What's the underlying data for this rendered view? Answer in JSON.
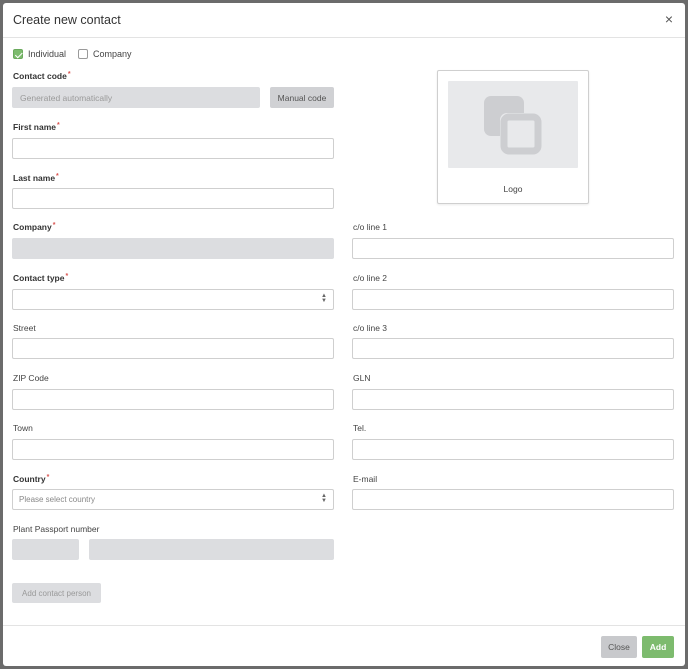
{
  "dialog": {
    "title": "Create new contact",
    "close_symbol": "×"
  },
  "type_options": {
    "individual": {
      "label": "Individual",
      "checked": true
    },
    "company": {
      "label": "Company",
      "checked": false
    }
  },
  "fields": {
    "contact_code": {
      "label": "Contact code",
      "required_mark": "*",
      "placeholder": "Generated automatically"
    },
    "manual_code_button": "Manual code",
    "first_name": {
      "label": "First name",
      "required_mark": "*",
      "value": ""
    },
    "last_name": {
      "label": "Last name",
      "required_mark": "*",
      "value": ""
    },
    "company": {
      "label": "Company",
      "required_mark": "*",
      "value": ""
    },
    "contact_type": {
      "label": "Contact type",
      "required_mark": "*",
      "selected": ""
    },
    "street": {
      "label": "Street",
      "value": ""
    },
    "zip_code": {
      "label": "ZIP Code",
      "value": ""
    },
    "town": {
      "label": "Town",
      "value": ""
    },
    "country": {
      "label": "Country",
      "required_mark": "*",
      "selected": "Please select country"
    },
    "plant_passport": {
      "label": "Plant Passport number"
    },
    "co_line_1": {
      "label": "c/o line 1",
      "value": ""
    },
    "co_line_2": {
      "label": "c/o line 2",
      "value": ""
    },
    "co_line_3": {
      "label": "c/o line 3",
      "value": ""
    },
    "gln": {
      "label": "GLN",
      "value": ""
    },
    "tel": {
      "label": "Tel.",
      "value": ""
    },
    "email": {
      "label": "E-mail",
      "value": ""
    }
  },
  "logo": {
    "label": "Logo",
    "icon": "image-placeholder-icon"
  },
  "add_contact_person_button": "Add contact person",
  "footer": {
    "close_label": "Close",
    "add_label": "Add"
  },
  "colors": {
    "accent": "#7dbb6e",
    "disabled_bg": "#dcdde0",
    "required": "#d9534f"
  }
}
